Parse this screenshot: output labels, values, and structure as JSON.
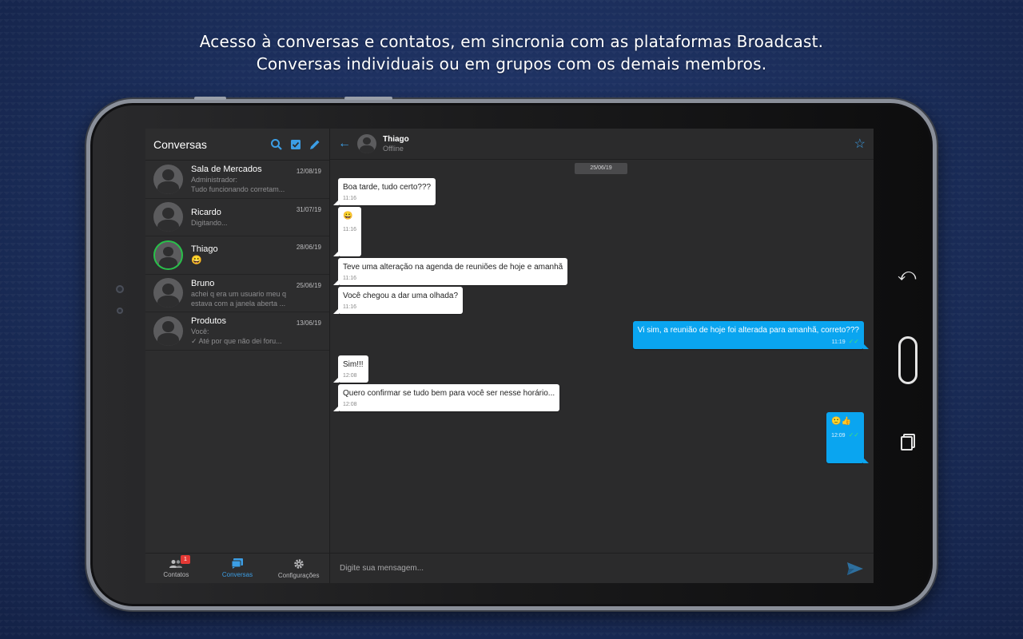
{
  "headline": {
    "line1": "Acesso à conversas e contatos, em sincronia com as plataformas Broadcast.",
    "line2": "Conversas individuais ou em grupos com os demais membros."
  },
  "sidebar": {
    "title": "Conversas",
    "icons": [
      "search-icon",
      "checkbox-icon",
      "pencil-icon"
    ],
    "conversations": [
      {
        "name": "Sala de Mercados",
        "date": "12/08/19",
        "line1": "Administrador:",
        "line2": "Tudo funcionando corretam...",
        "online": false
      },
      {
        "name": "Ricardo",
        "date": "31/07/19",
        "line1": "Digitando...",
        "line2": "",
        "online": false
      },
      {
        "name": "Thiago",
        "date": "28/06/19",
        "line1": "😀",
        "line2": "",
        "online": true
      },
      {
        "name": "Bruno",
        "date": "25/06/19",
        "line1": "achei q era um usuario meu q",
        "line2": "estava com a janela aberta ...",
        "online": false
      },
      {
        "name": "Produtos",
        "date": "13/06/19",
        "line1": "Você:",
        "line2": "✓ Até por que não dei foru...",
        "online": false
      }
    ],
    "nav": [
      {
        "label": "Contatos",
        "badge": "1",
        "icon": "contacts-icon"
      },
      {
        "label": "Conversas",
        "icon": "chat-icon",
        "active": true
      },
      {
        "label": "Configurações",
        "icon": "gear-icon"
      }
    ]
  },
  "chat": {
    "contact_name": "Thiago",
    "contact_status": "Offline",
    "date_chip": "25/06/19",
    "messages": [
      {
        "dir": "in",
        "text": "Boa tarde, tudo certo???",
        "time": "11:16"
      },
      {
        "dir": "in",
        "text": "😀",
        "time": "11:16"
      },
      {
        "dir": "in",
        "text": "Teve uma alteração na agenda de reuniões de hoje e amanhã",
        "time": "11:16"
      },
      {
        "dir": "in",
        "text": "Você chegou a dar uma olhada?",
        "time": "11:16"
      },
      {
        "dir": "out",
        "text": "Vi sim, a reunião de hoje foi alterada para amanhã, correto???",
        "time": "11:19"
      },
      {
        "dir": "in",
        "text": "Sim!!!",
        "time": "12:08"
      },
      {
        "dir": "in",
        "text": "Quero confirmar se tudo bem para você ser nesse horário...",
        "time": "12:08"
      },
      {
        "dir": "out",
        "text": "🙂👍",
        "time": "12:09"
      }
    ],
    "composer_placeholder": "Digite sua mensagem..."
  },
  "colors": {
    "accent": "#3c9ee5",
    "outgoing_bubble": "#0aa5f0",
    "online_ring": "#29c04a",
    "badge": "#e53935"
  }
}
